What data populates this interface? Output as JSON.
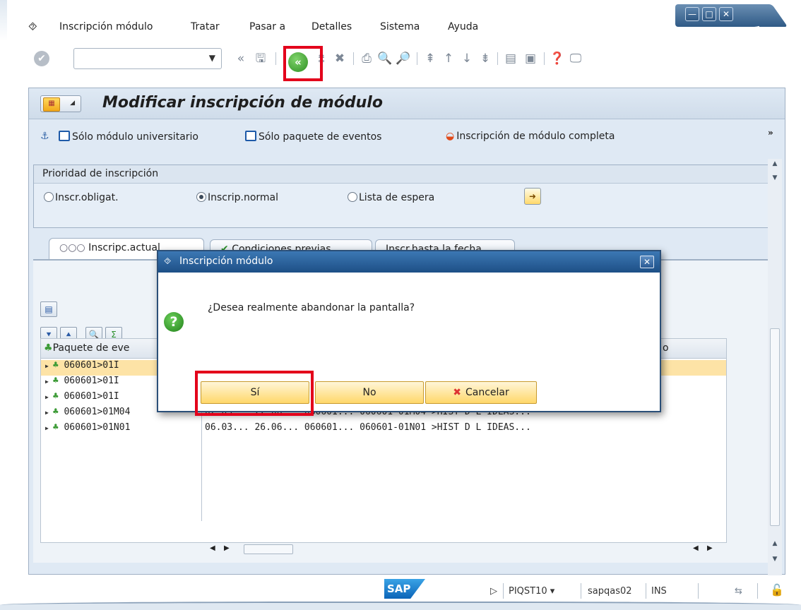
{
  "menu": {
    "items": [
      "Inscripción módulo",
      "Tratar",
      "Pasar a",
      "Detalles",
      "Sistema",
      "Ayuda"
    ]
  },
  "toolbar": {
    "command_value": "",
    "icons": [
      "enter-icon",
      "save-icon",
      "back-icon",
      "exit-icon",
      "cancel-icon",
      "print-icon",
      "find-icon",
      "find-next-icon",
      "first-page-icon",
      "prev-page-icon",
      "next-page-icon",
      "last-page-icon",
      "new-session-icon",
      "shortcut-icon",
      "help-icon",
      "customize-icon"
    ]
  },
  "screen": {
    "title": "Modificar inscripción de módulo"
  },
  "app_toolbar": {
    "only_module": "Sólo módulo universitario",
    "only_package": "Sólo paquete de eventos",
    "complete": "Inscripción de módulo completa"
  },
  "priority": {
    "title": "Prioridad de inscripción",
    "options": [
      "Inscr.obligat.",
      "Inscrip.normal",
      "Lista de espera"
    ],
    "selected": "Inscrip.normal"
  },
  "tabs": {
    "tab1": "Inscripc.actual",
    "tab2": "Condiciones previas",
    "tab3": "Inscr.hasta la fecha"
  },
  "grid": {
    "col1": "Paquete de eve",
    "col_last": "o",
    "rows": [
      {
        "c1": "060601>01I",
        "rest": ""
      },
      {
        "c1": "060601>01I",
        "rest": ""
      },
      {
        "c1": "060601>01I",
        "rest": ""
      },
      {
        "c1": "060601>01M04",
        "rest": "02.03... 22.06...  060601... 060601-01M04 >HIST D L IDEAS..."
      },
      {
        "c1": "060601>01N01",
        "rest": "06.03... 26.06...  060601... 060601-01N01 >HIST D L IDEAS..."
      }
    ]
  },
  "dialog": {
    "title": "Inscripción módulo",
    "question": "¿Desea realmente abandonar la pantalla?",
    "yes": "Sí",
    "no": "No",
    "cancel": "Cancelar"
  },
  "status": {
    "transaction": "PIQST10",
    "server": "sapqas02",
    "mode": "INS",
    "logo": "SAP"
  }
}
